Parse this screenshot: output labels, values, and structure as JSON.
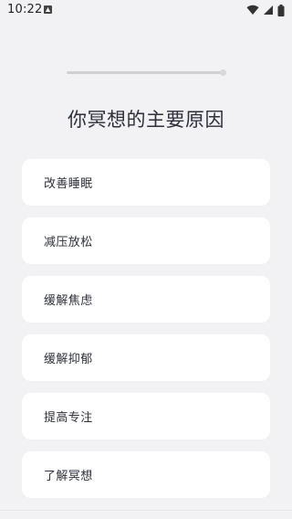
{
  "status_bar": {
    "time": "10:22",
    "icons": [
      "notification-icon",
      "wifi-icon",
      "signal-icon",
      "battery-icon"
    ]
  },
  "progress": {
    "value": 1.0
  },
  "title": "你冥想的主要原因",
  "options": [
    {
      "label": "改善睡眠"
    },
    {
      "label": "减压放松"
    },
    {
      "label": "缓解焦虑"
    },
    {
      "label": "缓解抑郁"
    },
    {
      "label": "提高专注"
    },
    {
      "label": "了解冥想"
    }
  ],
  "colors": {
    "background": "#f2f2f4",
    "card": "#ffffff",
    "text": "#2c2f3a"
  }
}
